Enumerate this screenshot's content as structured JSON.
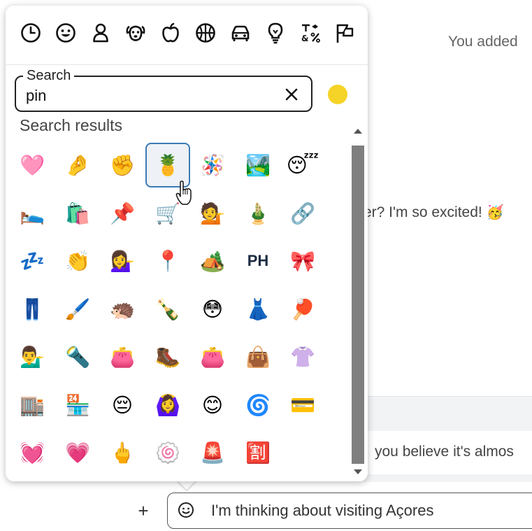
{
  "background": {
    "added_text": "You added",
    "message_1_text": "er? I'm so excited!",
    "message_1_emoji": "🥳",
    "message_2_text": "you believe it's almos"
  },
  "composer": {
    "plus_label": "+",
    "input_value": "I'm thinking about visiting Açores",
    "smiley_icon": "smiley-face-icon"
  },
  "emoji_picker": {
    "categories": [
      {
        "icon": "recent-clock-icon"
      },
      {
        "icon": "smileys-icon"
      },
      {
        "icon": "people-icon"
      },
      {
        "icon": "animals-icon"
      },
      {
        "icon": "food-apple-icon"
      },
      {
        "icon": "activity-ball-icon"
      },
      {
        "icon": "travel-car-icon"
      },
      {
        "icon": "objects-bulb-icon"
      },
      {
        "icon": "symbols-icon"
      },
      {
        "icon": "flags-icon"
      }
    ],
    "search": {
      "legend": "Search",
      "value": "pin",
      "clear_label": "✕"
    },
    "skin_tone_color": "#f6d327",
    "results_label": "Search results",
    "selected_index": 3,
    "results": [
      "🩷",
      "🤌",
      "✊",
      "🍍",
      "🪅",
      "🏞️",
      "😴",
      "🛌",
      "🛍️",
      "📌",
      "🛒",
      "💁",
      "🎍",
      "🔗",
      "💤",
      "👏",
      "💁‍♀️",
      "📍",
      "🏕️",
      "PH",
      "🎀",
      "👖",
      "🖌️",
      "🦔",
      "🍾",
      "😳",
      "👗",
      "🏓",
      "💁‍♂️",
      "🔦",
      "👛",
      "🥾",
      "👛",
      "👜",
      "👚",
      "🏬",
      "🏪",
      "😔",
      "🙆‍♀️",
      "😊",
      "🌀",
      "💳",
      "💓",
      "💗",
      "🖕",
      "🍥",
      "🚨",
      "🈹"
    ]
  }
}
